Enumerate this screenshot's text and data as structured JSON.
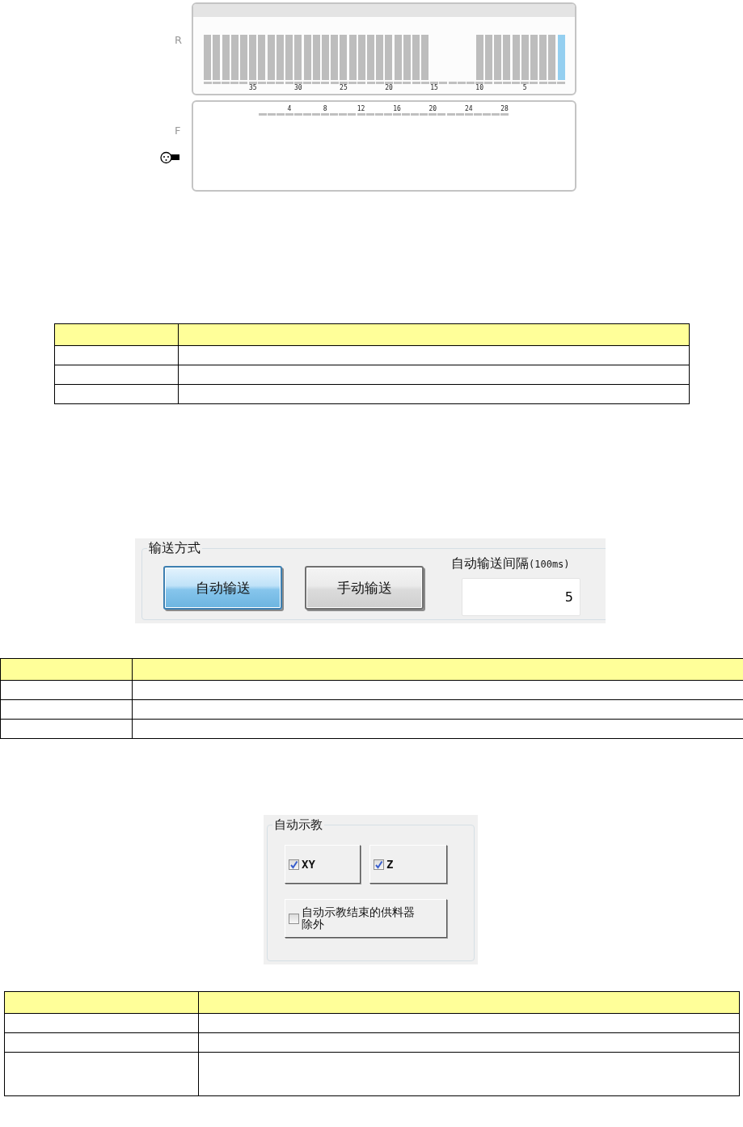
{
  "feeder_panel": {
    "rear": {
      "label": "R",
      "slots": [
        {
          "kind": "bar"
        },
        {
          "kind": "bar"
        },
        {
          "kind": "bar"
        },
        {
          "kind": "bar"
        },
        {
          "kind": "bar"
        },
        {
          "kind": "bar",
          "label": "35"
        },
        {
          "kind": "bar"
        },
        {
          "kind": "bar"
        },
        {
          "kind": "bar"
        },
        {
          "kind": "bar"
        },
        {
          "kind": "bar",
          "label": "30"
        },
        {
          "kind": "bar"
        },
        {
          "kind": "bar"
        },
        {
          "kind": "bar"
        },
        {
          "kind": "bar"
        },
        {
          "kind": "bar",
          "label": "25"
        },
        {
          "kind": "bar"
        },
        {
          "kind": "bar"
        },
        {
          "kind": "bar"
        },
        {
          "kind": "bar"
        },
        {
          "kind": "bar",
          "label": "20"
        },
        {
          "kind": "bar"
        },
        {
          "kind": "bar"
        },
        {
          "kind": "bar"
        },
        {
          "kind": "bar"
        },
        {
          "kind": "empty",
          "label": "15"
        },
        {
          "kind": "empty"
        },
        {
          "kind": "empty"
        },
        {
          "kind": "empty"
        },
        {
          "kind": "empty"
        },
        {
          "kind": "bar",
          "label": "10"
        },
        {
          "kind": "bar"
        },
        {
          "kind": "bar"
        },
        {
          "kind": "bar"
        },
        {
          "kind": "bar"
        },
        {
          "kind": "bar",
          "label": "5"
        },
        {
          "kind": "bar"
        },
        {
          "kind": "bar"
        },
        {
          "kind": "bar"
        },
        {
          "kind": "lit"
        }
      ]
    },
    "front": {
      "label": "F",
      "slots": [
        {
          "kind": "dash"
        },
        {
          "kind": "dash"
        },
        {
          "kind": "dash"
        },
        {
          "kind": "dash",
          "label": "4"
        },
        {
          "kind": "dash"
        },
        {
          "kind": "dash"
        },
        {
          "kind": "dash"
        },
        {
          "kind": "dash",
          "label": "8"
        },
        {
          "kind": "dash"
        },
        {
          "kind": "dash"
        },
        {
          "kind": "dash"
        },
        {
          "kind": "dash",
          "label": "12"
        },
        {
          "kind": "dash"
        },
        {
          "kind": "dash"
        },
        {
          "kind": "dash"
        },
        {
          "kind": "dash",
          "label": "16"
        },
        {
          "kind": "dash"
        },
        {
          "kind": "dash"
        },
        {
          "kind": "dash"
        },
        {
          "kind": "dash",
          "label": "20"
        },
        {
          "kind": "dash"
        },
        {
          "kind": "dash"
        },
        {
          "kind": "dash"
        },
        {
          "kind": "dash",
          "label": "24"
        },
        {
          "kind": "dash"
        },
        {
          "kind": "dash"
        },
        {
          "kind": "dash"
        },
        {
          "kind": "dash",
          "label": "28"
        }
      ]
    }
  },
  "transfer_group": {
    "title": "输送方式",
    "buttons": [
      {
        "label": "自动输送",
        "selected": true
      },
      {
        "label": "手动输送",
        "selected": false
      }
    ],
    "interval": {
      "label": "自动输送间隔",
      "unit": "(100ms)",
      "value": "5"
    }
  },
  "auto_teach_group": {
    "title": "自动示教",
    "options": [
      {
        "label": "XY",
        "checked": true
      },
      {
        "label": "Z",
        "checked": true
      },
      {
        "label": "自动示教结束的供料器除外",
        "checked": false
      }
    ]
  }
}
